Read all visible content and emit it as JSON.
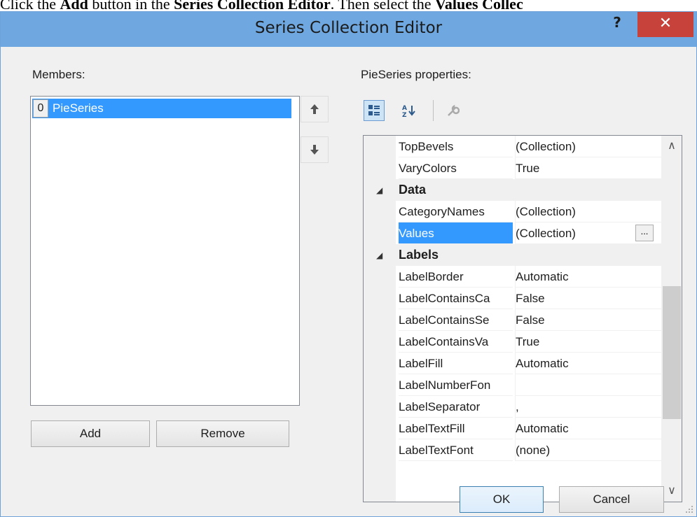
{
  "doc_line": {
    "prefix": "Click the ",
    "b1": "Add",
    "mid1": " button in the ",
    "b2": "Series Collection Editor",
    "mid2": ". Then select the ",
    "b3": "Values Collec"
  },
  "window": {
    "title": "Series Collection Editor",
    "help": "?",
    "close": "✕"
  },
  "members": {
    "label": "Members:",
    "items": [
      {
        "index": "0",
        "label": "PieSeries"
      }
    ],
    "add_label": "Add",
    "remove_label": "Remove"
  },
  "properties": {
    "label": "PieSeries properties:",
    "rows": [
      {
        "type": "prop",
        "name": "TopBevels",
        "value": "(Collection)"
      },
      {
        "type": "prop",
        "name": "VaryColors",
        "value": "True"
      },
      {
        "type": "category",
        "name": "Data"
      },
      {
        "type": "prop",
        "name": "CategoryNames",
        "value": "(Collection)"
      },
      {
        "type": "prop",
        "name": "Values",
        "value": "(Collection)",
        "selected": true,
        "button": "..."
      },
      {
        "type": "category",
        "name": "Labels"
      },
      {
        "type": "prop",
        "name": "LabelBorder",
        "value": "Automatic"
      },
      {
        "type": "prop",
        "name": "LabelContainsCa",
        "value": "False"
      },
      {
        "type": "prop",
        "name": "LabelContainsSe",
        "value": "False"
      },
      {
        "type": "prop",
        "name": "LabelContainsVa",
        "value": "True"
      },
      {
        "type": "prop",
        "name": "LabelFill",
        "value": "Automatic"
      },
      {
        "type": "prop",
        "name": "LabelNumberFon",
        "value": ""
      },
      {
        "type": "prop",
        "name": "LabelSeparator",
        "value": ","
      },
      {
        "type": "prop",
        "name": "LabelTextFill",
        "value": "Automatic"
      },
      {
        "type": "prop",
        "name": "LabelTextFont",
        "value": "(none)"
      }
    ]
  },
  "footer": {
    "ok_label": "OK",
    "cancel_label": "Cancel"
  },
  "colors": {
    "titlebar": "#6fa8e0",
    "close": "#c7423b",
    "selection": "#3399ff"
  }
}
